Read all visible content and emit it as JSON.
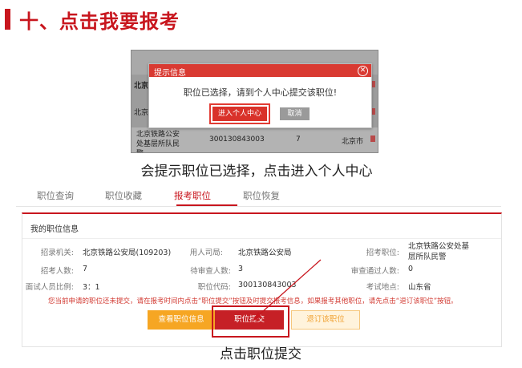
{
  "heading": {
    "text": "十、点击我要报考"
  },
  "screenshot1": {
    "bg_rows": [
      {
        "col1": "北京"
      },
      {
        "col1": "北京"
      },
      {
        "col1": "北京铁路公安处基层所队民警",
        "col2": "300130843003",
        "col3": "7",
        "col4": "北京市"
      }
    ],
    "dialog": {
      "title": "提示信息",
      "close_glyph": "✕",
      "message": "职位已选择，请到个人中心提交该职位!",
      "enter_button": "进入个人中心",
      "cancel_button": "取消"
    }
  },
  "caption1": "会提示职位已选择，点击进入个人中心",
  "tabs": [
    {
      "label": "职位查询",
      "active": false
    },
    {
      "label": "职位收藏",
      "active": false
    },
    {
      "label": "报考职位",
      "active": true
    },
    {
      "label": "职位恢复",
      "active": false
    }
  ],
  "panel": {
    "title": "我的职位信息",
    "fields": {
      "recruit_org_label": "招录机关:",
      "recruit_org_value": "北京铁路公安局(109203)",
      "employer_label": "用人司局:",
      "employer_value": "北京铁路公安局",
      "position_label": "招考职位:",
      "position_value_line1": "北京铁路公安处基",
      "position_value_line2": "层所队民警",
      "quota_label": "招考人数:",
      "quota_value": "7",
      "pending_label": "待审查人数:",
      "pending_value": "3",
      "passed_label": "审查通过人数:",
      "passed_value": "0",
      "ratio_label": "面试人员比例:",
      "ratio_value": "3：1",
      "code_label": "职位代码:",
      "code_value": "300130843003",
      "exam_place_label": "考试地点:",
      "exam_place_value": "山东省"
    },
    "notice": "您当前申请的职位还未提交，请在报考时间内点击“职位提交”按钮及时提交报考信息，如果报考其他职位，请先点击“退订该职位”按钮。",
    "buttons": {
      "view": "查看职位信息",
      "submit": "职位提交",
      "cancel": "退订该职位"
    }
  },
  "caption2": "点击职位提交",
  "colors": {
    "accent": "#c8161e",
    "orange": "#f6a623",
    "dialog_title": "#d93a32"
  }
}
